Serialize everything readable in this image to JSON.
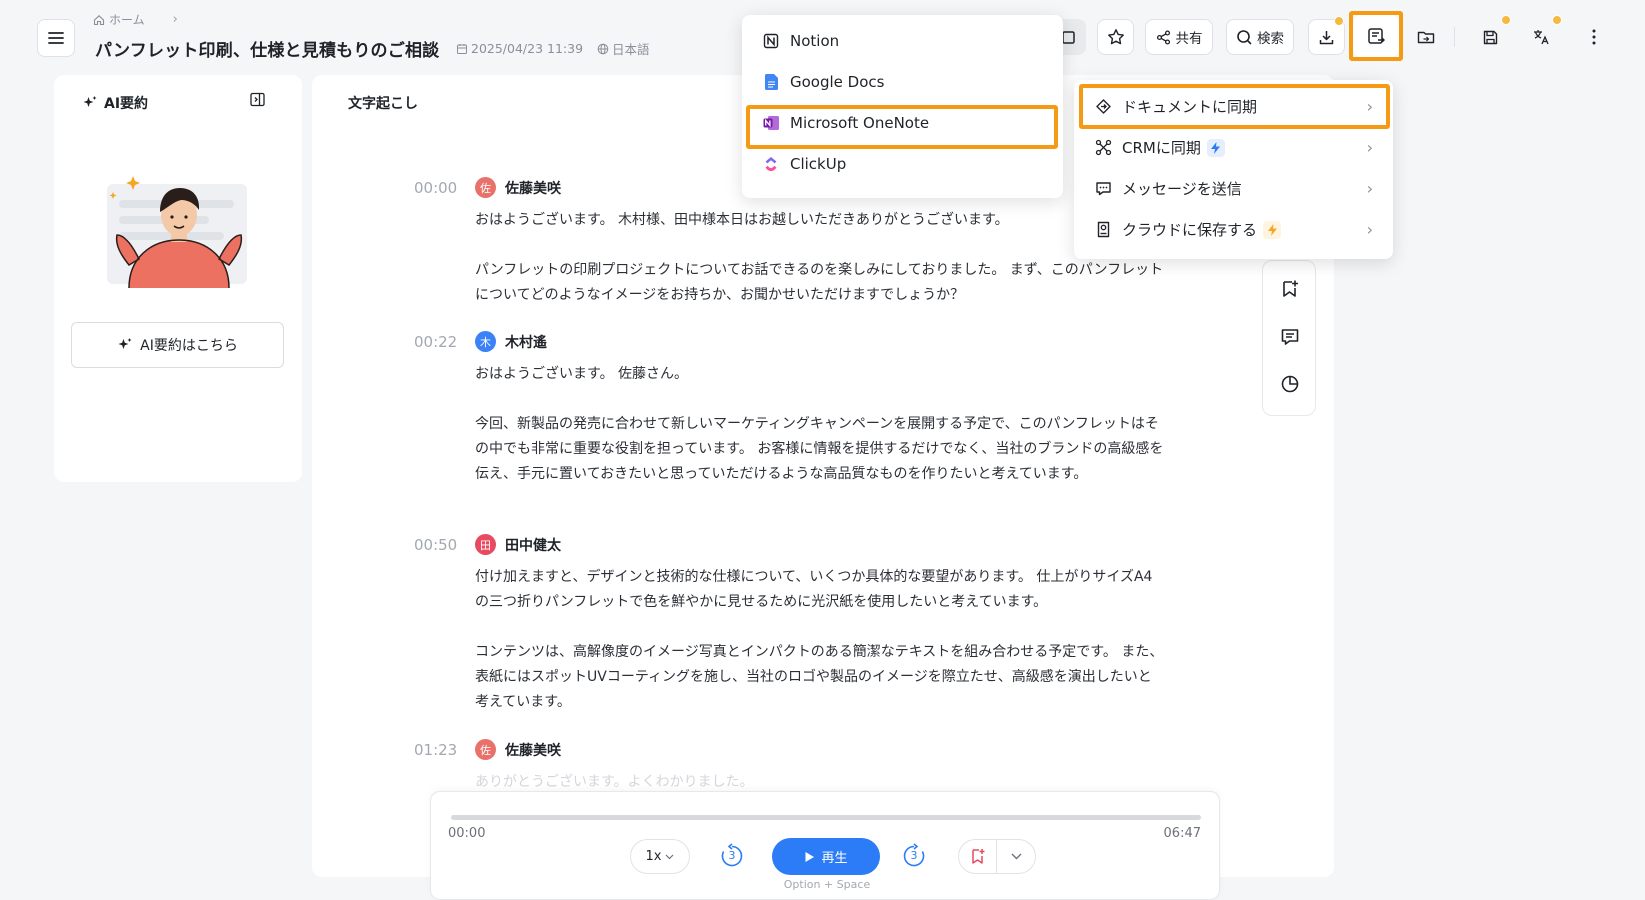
{
  "header": {
    "breadcrumb_home": "ホーム",
    "breadcrumb_sep": "›",
    "title": "パンフレット印刷、仕様と見積もりのご相談",
    "datetime": "2025/04/23 11:39",
    "language": "日本語"
  },
  "toolbar": {
    "share_label": "共有",
    "search_label": "検索"
  },
  "left_panel": {
    "title": "AI要約",
    "button_label": "AI要約はこちら"
  },
  "transcript": {
    "title": "文字起こし",
    "segments": [
      {
        "time": "00:00",
        "avatar": "佐",
        "speaker": "佐藤美咲",
        "paragraphs": [
          "おはようございます。 木村様、田中様本日はお越しいただきありがとうございます。",
          "パンフレットの印刷プロジェクトについてお話できるのを楽しみにしておりました。 まず、このパンフレットについてどのようなイメージをお持ちか、お聞かせいただけますでしょうか？"
        ]
      },
      {
        "time": "00:22",
        "avatar": "木",
        "speaker": "木村遙",
        "paragraphs": [
          "おはようございます。 佐藤さん。",
          "今回、新製品の発売に合わせて新しいマーケティングキャンペーンを展開する予定で、このパンフレットはその中でも非常に重要な役割を担っています。 お客様に情報を提供するだけでなく、当社のブランドの高級感を伝え、手元に置いておきたいと思っていただけるような高品質なものを作りたいと考えています。"
        ]
      },
      {
        "time": "00:50",
        "avatar": "田",
        "speaker": "田中健太",
        "paragraphs": [
          "付け加えますと、デザインと技術的な仕様について、いくつか具体的な要望があります。 仕上がりサイズA4の三つ折りパンフレットで色を鮮やかに見せるために光沢紙を使用したいと考えています。",
          "コンテンツは、高解像度のイメージ写真とインパクトのある簡潔なテキストを組み合わせる予定です。 また、表紙にはスポットUVコーティングを施し、当社のロゴや製品のイメージを際立たせ、高級感を演出したいと考えています。"
        ]
      },
      {
        "time": "01:23",
        "avatar": "佐",
        "speaker": "佐藤美咲",
        "paragraphs": [
          "ありがとうございます。よくわかりました。"
        ]
      }
    ]
  },
  "player": {
    "current_time": "00:00",
    "duration": "06:47",
    "speed": "1x",
    "skip_back": "3",
    "skip_forward": "3",
    "play_label": "再生",
    "shortcut_hint": "Option + Space",
    "progress": 0
  },
  "doc_menu": {
    "items": [
      "Notion",
      "Google Docs",
      "Microsoft OneNote",
      "ClickUp"
    ],
    "highlighted": "Microsoft OneNote"
  },
  "sync_menu": {
    "items": [
      "ドキュメントに同期",
      "CRMに同期",
      "メッセージを送信",
      "クラウドに保存する"
    ],
    "highlighted": "ドキュメントに同期"
  },
  "colors": {
    "accent": "#2b7cf6",
    "highlight": "#f59a14",
    "badge": "#f5b841",
    "avatar_sato": "#e8716a",
    "avatar_kimura": "#3b82f6",
    "avatar_tanaka": "#e84a5f"
  }
}
